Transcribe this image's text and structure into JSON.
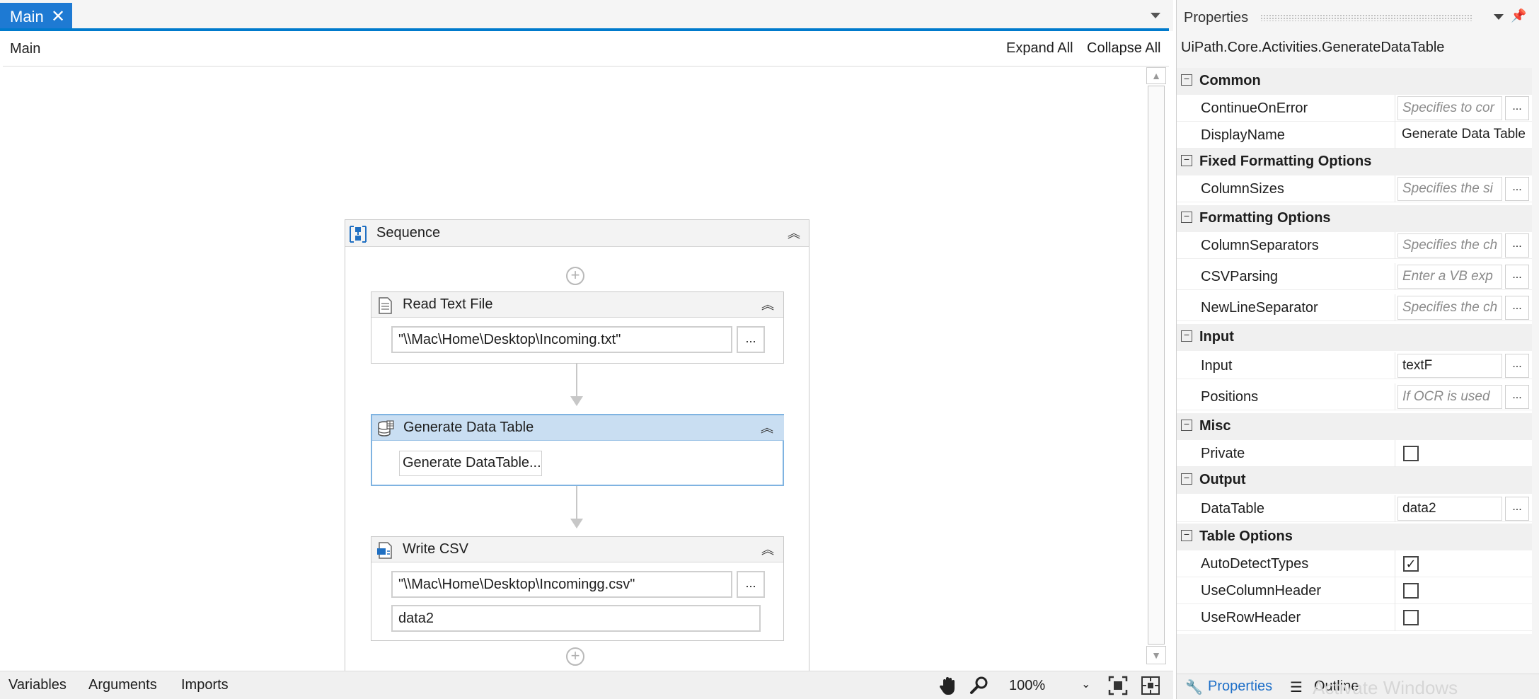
{
  "designer": {
    "tab_label": "Main",
    "tab_close": "✕",
    "breadcrumb": "Main",
    "expand_all": "Expand All",
    "collapse_all": "Collapse All",
    "sequence": {
      "title": "Sequence",
      "activities": [
        {
          "title": "Read Text File",
          "file_value": "\"\\\\Mac\\Home\\Desktop\\Incoming.txt\"",
          "button": "..."
        },
        {
          "title": "Generate Data Table",
          "button_label": "Generate DataTable..."
        },
        {
          "title": "Write CSV",
          "file_value": "\"\\\\Mac\\Home\\Desktop\\Incomingg.csv\"",
          "button": "...",
          "datatable_value": "data2"
        }
      ]
    },
    "statusbar": {
      "variables": "Variables",
      "arguments": "Arguments",
      "imports": "Imports",
      "zoom": "100%"
    }
  },
  "properties": {
    "title": "Properties",
    "type_name": "UiPath.Core.Activities.GenerateDataTable",
    "categories": [
      {
        "name": "Common",
        "rows": [
          {
            "name": "ContinueOnError",
            "value": "Specifies to cor",
            "hint": true,
            "button": "..."
          },
          {
            "name": "DisplayName",
            "value": "Generate Data Table",
            "hint": false
          }
        ]
      },
      {
        "name": "Fixed Formatting Options",
        "rows": [
          {
            "name": "ColumnSizes",
            "value": "Specifies the si",
            "hint": true,
            "button": "..."
          }
        ]
      },
      {
        "name": "Formatting Options",
        "rows": [
          {
            "name": "ColumnSeparators",
            "value": "Specifies the ch",
            "hint": true,
            "button": "..."
          },
          {
            "name": "CSVParsing",
            "value": "Enter a VB exp",
            "hint": true,
            "button": "..."
          },
          {
            "name": "NewLineSeparator",
            "value": "Specifies the ch",
            "hint": true,
            "button": "..."
          }
        ]
      },
      {
        "name": "Input",
        "rows": [
          {
            "name": "Input",
            "value": "textF",
            "hint": false,
            "button": "..."
          },
          {
            "name": "Positions",
            "value": "If OCR is used",
            "hint": true,
            "button": "..."
          }
        ]
      },
      {
        "name": "Misc",
        "rows": [
          {
            "name": "Private",
            "checked": false
          }
        ]
      },
      {
        "name": "Output",
        "rows": [
          {
            "name": "DataTable",
            "value": "data2",
            "hint": false,
            "button": "..."
          }
        ]
      },
      {
        "name": "Table Options",
        "rows": [
          {
            "name": "AutoDetectTypes",
            "checked": true
          },
          {
            "name": "UseColumnHeader",
            "checked": false
          },
          {
            "name": "UseRowHeader",
            "checked": false
          }
        ]
      }
    ],
    "footer": {
      "properties_tab": "Properties",
      "outline_tab": "Outline",
      "watermark": "Activate Windows"
    }
  },
  "colors": {
    "accent": "#007acc",
    "tab_active": "#1e7ad3",
    "selected_header": "#c9def2"
  }
}
